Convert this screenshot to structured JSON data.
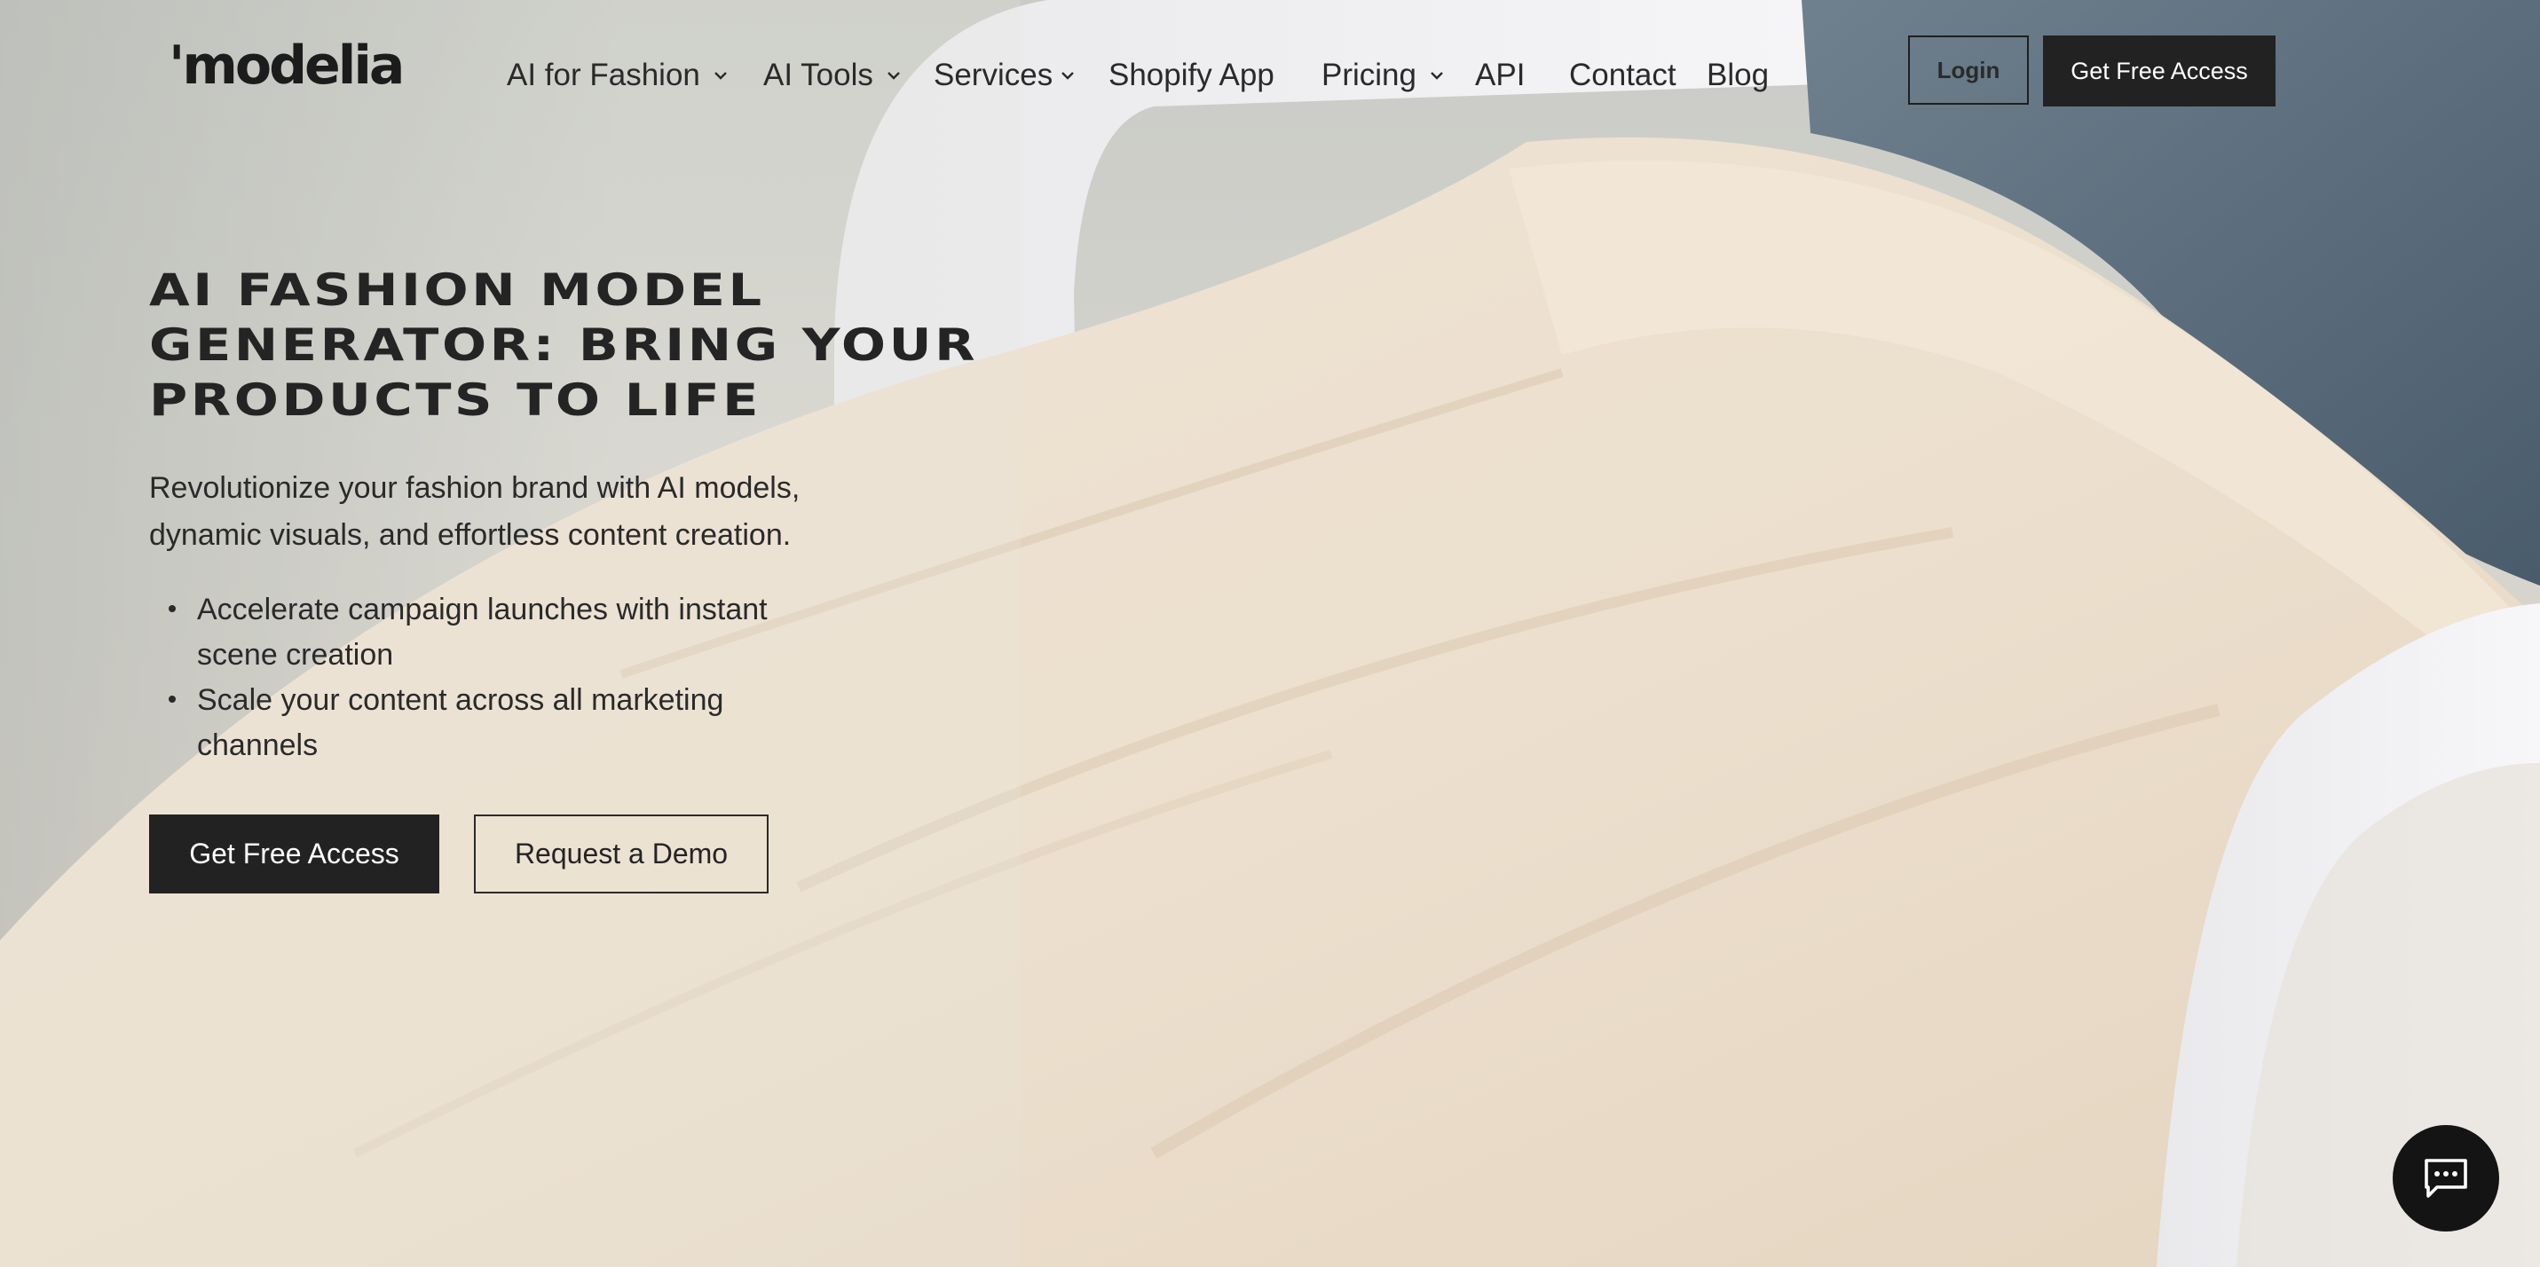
{
  "colors": {
    "dark": "#222222",
    "text": "#2a2a2a",
    "on_dark": "#ffffff",
    "chat_bg": "#141414"
  },
  "header": {
    "logo": "'modelia",
    "nav": [
      {
        "label": "AI for Fashion",
        "has_dropdown": true
      },
      {
        "label": "AI Tools",
        "has_dropdown": true
      },
      {
        "label": "Services",
        "has_dropdown": true
      },
      {
        "label": "Shopify App",
        "has_dropdown": false
      },
      {
        "label": "Pricing",
        "has_dropdown": true
      },
      {
        "label": "API",
        "has_dropdown": false
      },
      {
        "label": "Contact",
        "has_dropdown": false
      },
      {
        "label": "Blog",
        "has_dropdown": false
      }
    ],
    "login_label": "Login",
    "cta_label": "Get Free Access"
  },
  "hero": {
    "title_lines": [
      "AI FASHION MODEL",
      "GENERATOR: BRING YOUR",
      "PRODUCTS TO LIFE"
    ],
    "subtitle_lines": [
      "Revolutionize your fashion brand with AI models,",
      "dynamic visuals, and effortless content creation."
    ],
    "bullets": [
      [
        "Accelerate campaign launches with instant",
        "scene creation"
      ],
      [
        "Scale your content across all marketing",
        "channels"
      ]
    ],
    "primary_cta": "Get Free Access",
    "secondary_cta": "Request a Demo"
  },
  "icons": {
    "dropdown": "chevron-down-icon",
    "chat": "chat-bubble-icon"
  }
}
